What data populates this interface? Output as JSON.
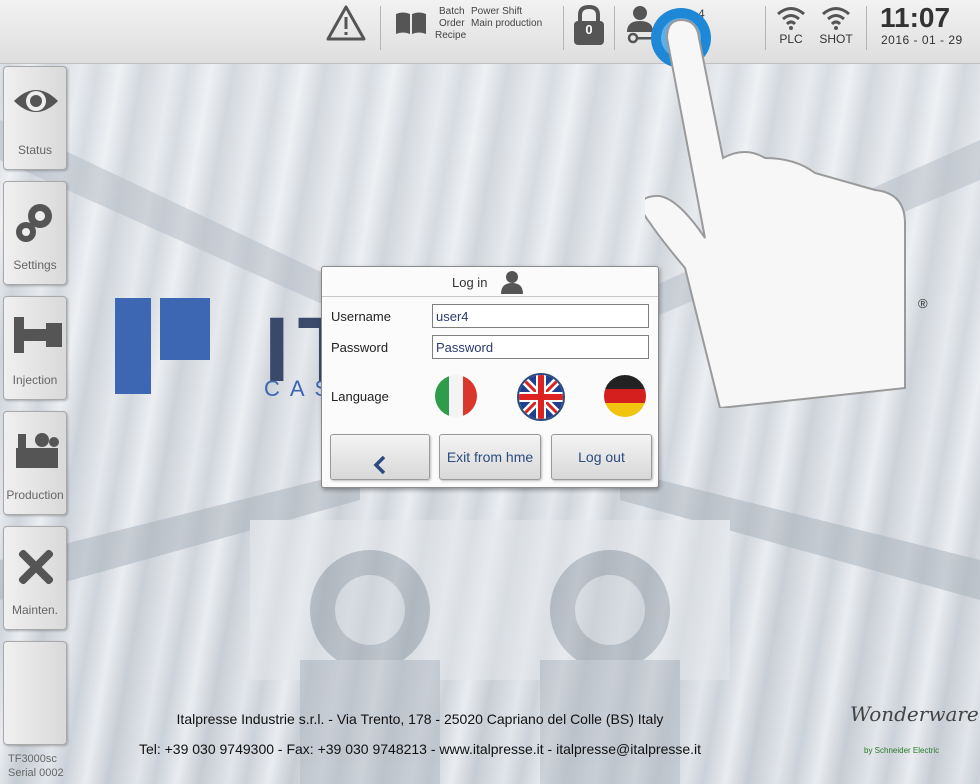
{
  "topbar": {
    "batch_label": "Batch",
    "order_label": "Order",
    "recipe_label": "Recipe",
    "shift_value": "Power Shift",
    "order_value": "Main production",
    "lock_count": "0",
    "user_count": "4",
    "plc_label": "PLC",
    "shot_label": "SHOT",
    "time": "11:07",
    "date": "2016 - 01 - 29"
  },
  "sidebar": {
    "items": [
      {
        "label": "Status",
        "icon": "eye-icon"
      },
      {
        "label": "Settings",
        "icon": "gears-icon"
      },
      {
        "label": "Injection",
        "icon": "injection-icon"
      },
      {
        "label": "Production",
        "icon": "factory-icon"
      },
      {
        "label": "Mainten.",
        "icon": "tools-icon"
      },
      {
        "label": "",
        "icon": ""
      }
    ],
    "serial_model": "TF3000sc",
    "serial_number": "Serial 0002"
  },
  "logo": {
    "text": "IT",
    "subtext": "CAS",
    "registered": "®"
  },
  "login": {
    "title": "Log in",
    "username_label": "Username",
    "username_value": "user4",
    "password_label": "Password",
    "password_value": "Password",
    "language_label": "Language",
    "back_label": "<",
    "exit_label": "Exit from hme",
    "logout_label": "Log out"
  },
  "footer": {
    "address": "Italpresse Industrie s.r.l. - Via Trento, 178 - 25020 Capriano del Colle (BS) Italy",
    "contact": "Tel: +39 030 9749300 - Fax: +39 030 9748213 - www.italpresse.it - italpresse@italpresse.it"
  },
  "brand": {
    "name": "Wonderware",
    "by": "by Schneider Electric"
  },
  "colors": {
    "accent": "#1e88d6",
    "logo_blue": "#3d66b3",
    "text_blue": "#2b4c7e"
  }
}
